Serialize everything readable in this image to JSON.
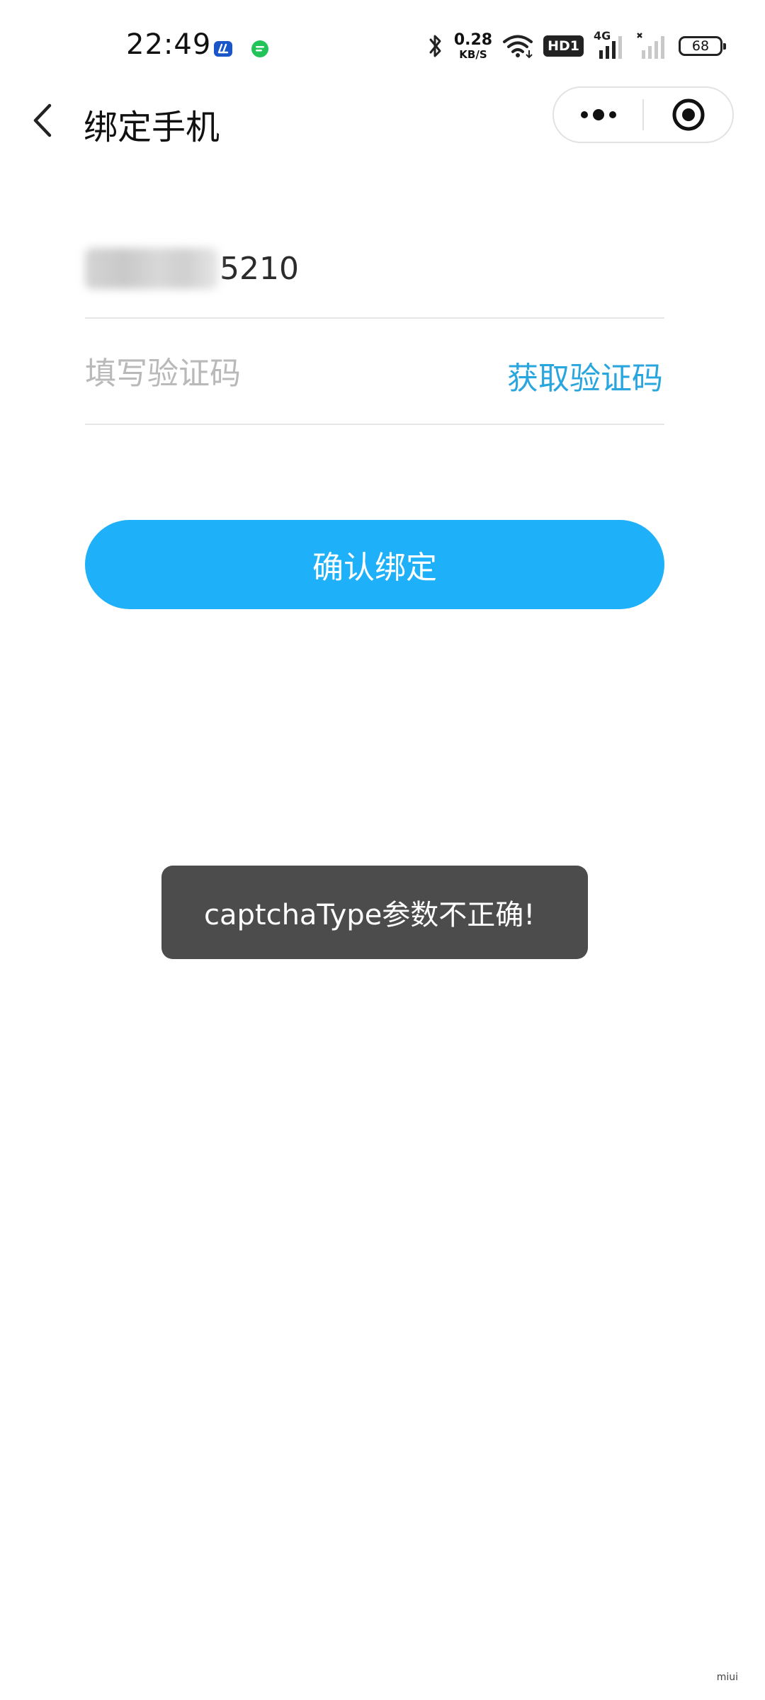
{
  "status_bar": {
    "time": "22:49",
    "speed_value": "0.28",
    "speed_unit": "KB/S",
    "hd_label": "HD1",
    "network_label": "4G",
    "battery": "68"
  },
  "header": {
    "title": "绑定手机"
  },
  "form": {
    "phone_suffix": "5210",
    "code_placeholder": "填写验证码",
    "get_code_label": "获取验证码",
    "confirm_label": "确认绑定"
  },
  "toast": {
    "message": "captchaType参数不正确!"
  },
  "corner_mark": "miui",
  "colors": {
    "accent": "#1eb0f8",
    "link": "#2aa6df",
    "toast_bg": "#4c4c4c"
  }
}
